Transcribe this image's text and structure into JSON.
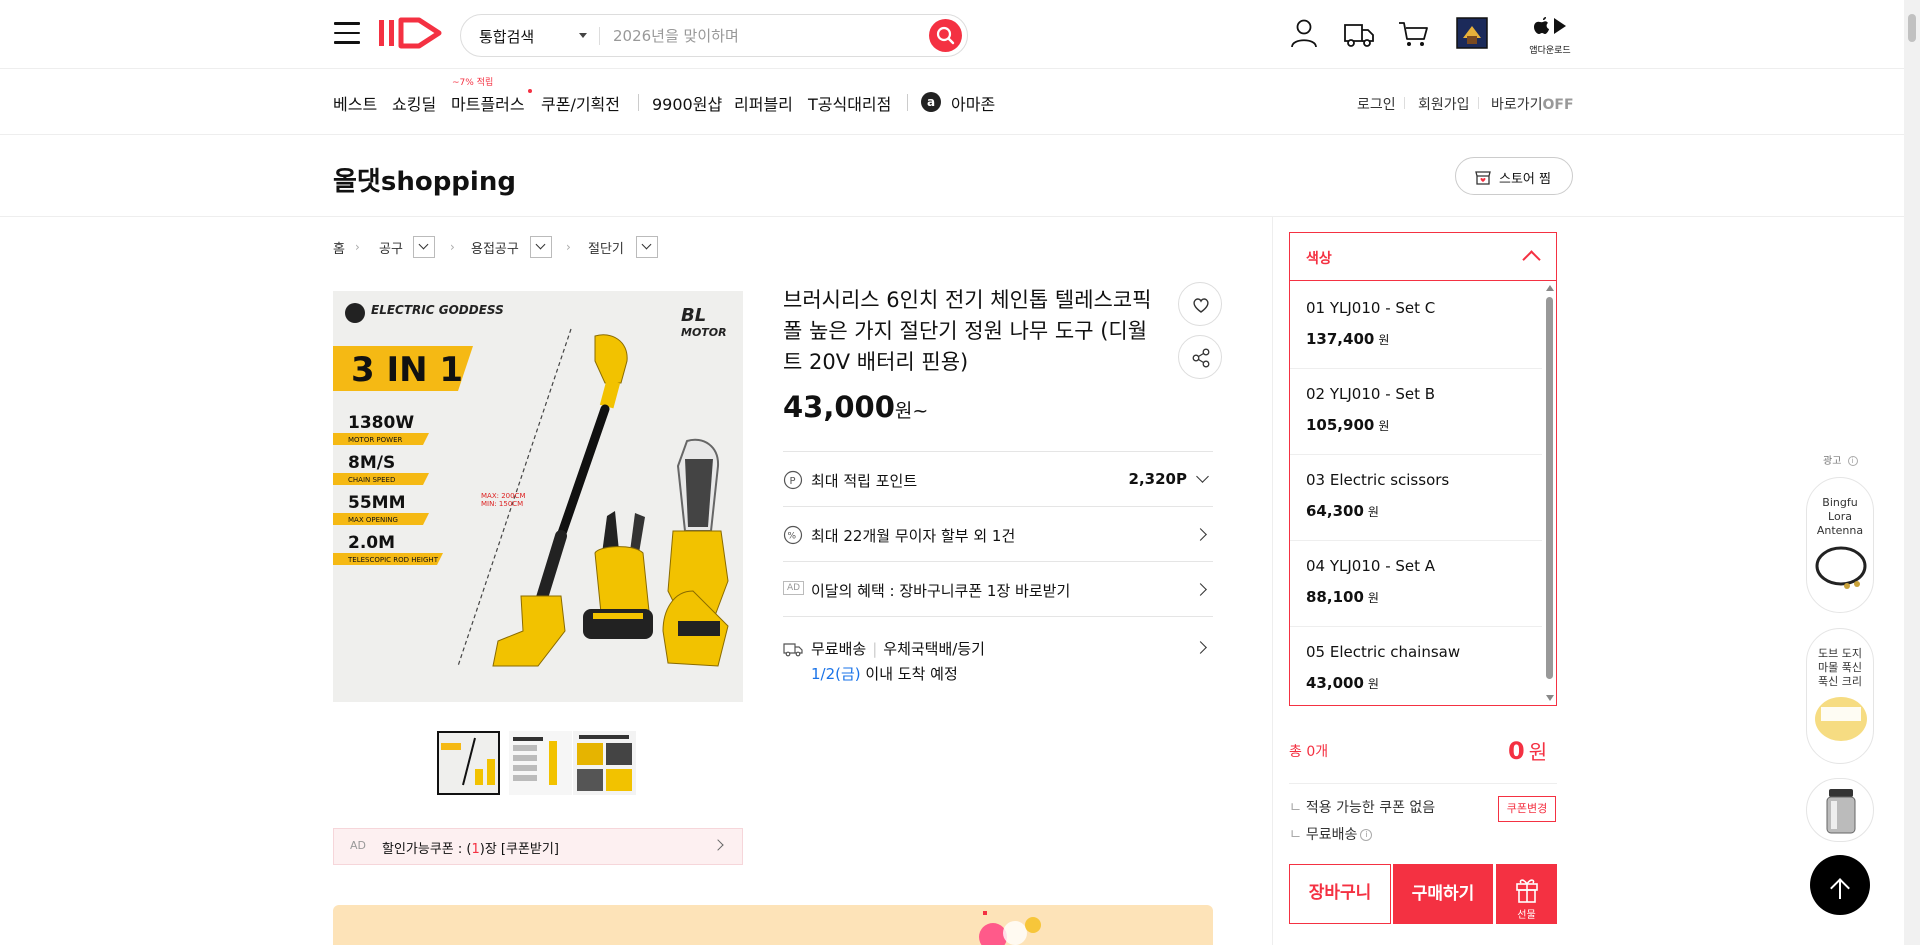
{
  "header": {
    "search_category": "통합검색",
    "search_placeholder": "2026년을 맞이하며",
    "app_download_label": "앱다운로드"
  },
  "gnb": {
    "items": [
      "베스트",
      "쇼킹딜",
      "마트플러스",
      "쿠폰/기획전",
      "9900원샵",
      "리퍼블리",
      "T공식대리점",
      "아마존"
    ],
    "mart_tag": "~7% 적립",
    "amazon_badge": "a",
    "util": [
      "로그인",
      "회원가입",
      "바로가기"
    ],
    "shortcut_state": "OFF"
  },
  "store": {
    "name": "올댓shopping",
    "fav_label": "스토어 찜"
  },
  "breadcrumb": [
    "홈",
    "공구",
    "용접공구",
    "절단기"
  ],
  "product": {
    "title": "브러시리스 6인치 전기 체인톱 텔레스코픽 폴 높은 가지 절단기 정원 나무 도구 (디월트 20V 배터리 핀용)",
    "price": "43,000",
    "price_unit": "원~",
    "image_text": {
      "brand": "ELECTRIC GODDESS",
      "motor": "BL MOTOR",
      "headline": "3 IN 1",
      "specs": [
        {
          "value": "1380W",
          "label": "MOTOR POWER"
        },
        {
          "value": "8M/S",
          "label": "CHAIN SPEED"
        },
        {
          "value": "55MM",
          "label": "MAX OPENING"
        },
        {
          "value": "2.0M",
          "label": "TELESCOPIC ROD HEIGHT"
        }
      ],
      "pole_max": "MAX: 200CM",
      "pole_min": "MIN: 150CM"
    },
    "points_label": "최대 적립 포인트",
    "points_value": "2,320P",
    "installment": "최대 22개월 무이자 할부 외 1건",
    "ad_badge": "AD",
    "benefit": "이달의 혜택 : 장바구니쿠폰 1장 바로받기",
    "shipping": "무료배송",
    "shipping_method": "우체국택배/등기",
    "arrival_date": "1/2(금)",
    "arrival_suffix": " 이내 도착 예정",
    "coupon_ad": "AD",
    "coupon_prefix": "할인가능쿠폰 : (",
    "coupon_count": "1",
    "coupon_suffix": ")장 [쿠폰받기]"
  },
  "options": {
    "header": "색상",
    "items": [
      {
        "name": "01 YLJ010 - Set C",
        "price": "137,400"
      },
      {
        "name": "02 YLJ010 - Set B",
        "price": "105,900"
      },
      {
        "name": "03 Electric scissors",
        "price": "64,300"
      },
      {
        "name": "04 YLJ010 - Set A",
        "price": "88,100"
      },
      {
        "name": "05 Electric chainsaw",
        "price": "43,000"
      }
    ],
    "currency": "원"
  },
  "order": {
    "total_label": "총 0개",
    "total_value": "0",
    "total_unit": "원",
    "no_coupon": "적용 가능한 쿠폰 없음",
    "coupon_change": "쿠폰변경",
    "free_ship": "무료배송",
    "cart_label": "장바구니",
    "buy_label": "구매하기",
    "gift_label": "선물"
  },
  "floating_ads": {
    "label": "광고",
    "cards": [
      {
        "title": "Bingfu Lora Antenna"
      },
      {
        "title": "도브 도지 마몰 푹신 푹신 크리"
      }
    ]
  },
  "colors": {
    "accent": "#f43142",
    "link_blue": "#1a73e8"
  }
}
